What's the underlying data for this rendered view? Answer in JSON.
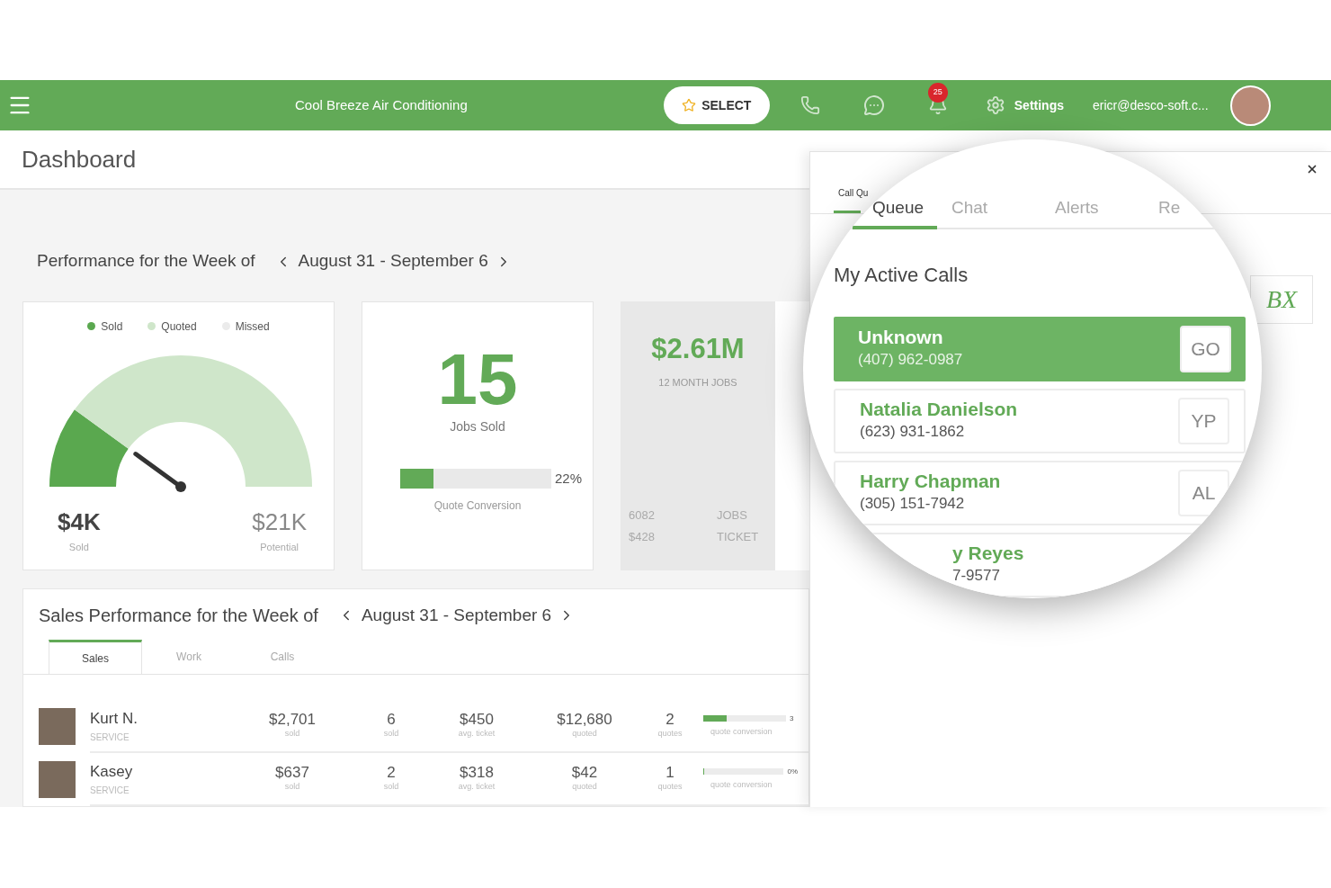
{
  "header": {
    "company": "Cool Breeze Air Conditioning",
    "select_button": "SELECT",
    "notification_count": "25",
    "settings": "Settings",
    "user_email": "ericr@desco-soft.c..."
  },
  "page_title": "Dashboard",
  "performance": {
    "title": "Performance for the Week of",
    "range": "August 31 - September 6"
  },
  "gauge": {
    "legend": [
      {
        "label": "Sold",
        "color": "#5aa84f"
      },
      {
        "label": "Quoted",
        "color": "#cfe6ca"
      },
      {
        "label": "Missed",
        "color": "#ebebeb"
      }
    ],
    "level": 0.2,
    "sold_value": "$4K",
    "sold_label": "Sold",
    "potential_value": "$21K",
    "potential_label": "Potential"
  },
  "jobs_card": {
    "value": "15",
    "label": "Jobs Sold",
    "level": 0.22,
    "reading": "22%",
    "conversion_label": "Quote Conversion"
  },
  "revenue_card": {
    "value": "$2.61M",
    "label": "12 MONTH JOBS",
    "stats": [
      {
        "value": "6082",
        "label": "JOBS"
      },
      {
        "value": "$428",
        "label": "TICKET"
      }
    ]
  },
  "sales": {
    "title": "Sales Performance for the Week of",
    "range": "August 31 - September 6",
    "tabs": [
      {
        "label": "Sales",
        "selected": true
      },
      {
        "label": "Work",
        "selected": false
      },
      {
        "label": "Calls",
        "selected": false
      }
    ],
    "rows": [
      {
        "name": "Kurt N.",
        "role": "SERVICE",
        "sold": "$2,701",
        "sold_label": "sold",
        "count": "6",
        "count_label": "sold",
        "avg": "$450",
        "avg_label": "avg. ticket",
        "quoted": "$12,680",
        "quoted_label": "quoted",
        "quotes": "2",
        "quotes_label": "quotes",
        "level": 0.28,
        "reading": "3",
        "conversion_label": "quote conversion"
      },
      {
        "name": "Kasey",
        "role": "SERVICE",
        "sold": "$637",
        "sold_label": "sold",
        "count": "2",
        "count_label": "sold",
        "avg": "$318",
        "avg_label": "avg. ticket",
        "quoted": "$42",
        "quoted_label": "quoted",
        "quotes": "1",
        "quotes_label": "quotes",
        "level": 0,
        "reading": "0%",
        "conversion_label": "quote conversion"
      }
    ]
  },
  "panel": {
    "tab_label": "Call Qu",
    "logo": "BX",
    "lens": {
      "tabs": [
        {
          "label": "Queue",
          "selected": true
        },
        {
          "label": "Chat",
          "selected": false
        },
        {
          "label": "Alerts",
          "selected": false
        },
        {
          "label": "Re",
          "selected": false
        }
      ],
      "section_title": "My Active Calls",
      "calls": [
        {
          "name": "Unknown",
          "phone": "(407) 962-0987",
          "button": "GO",
          "selected": true,
          "partial": false
        },
        {
          "name": "Natalia Danielson",
          "phone": "(623) 931-1862",
          "button": "YP",
          "selected": false,
          "partial": false
        },
        {
          "name": "Harry Chapman",
          "phone": "(305) 151-7942",
          "button": "AL",
          "selected": false,
          "partial": false
        },
        {
          "name": "y Reyes",
          "phone": "7-9577",
          "selected": false,
          "partial": true
        }
      ]
    }
  }
}
